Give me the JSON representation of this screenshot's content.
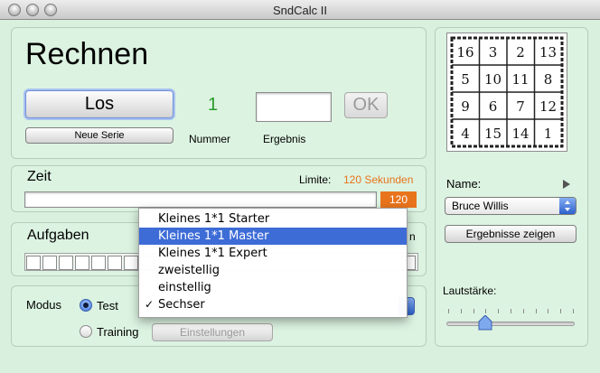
{
  "window": {
    "title": "SndCalc II"
  },
  "rechnen": {
    "heading": "Rechnen",
    "los_label": "Los",
    "neue_serie_label": "Neue Serie",
    "nummer_value": "1",
    "nummer_label": "Nummer",
    "ergebnis_label": "Ergebnis",
    "ok_label": "OK"
  },
  "zeit": {
    "heading": "Zeit",
    "limite_label": "Limite:",
    "limite_value": "120 Sekunden",
    "counter": "120"
  },
  "aufgaben": {
    "heading": "Aufgaben",
    "right_fragment": "n"
  },
  "modus": {
    "label": "Modus",
    "option_test": "Test",
    "option_training": "Training",
    "selected": "Test",
    "einstellungen_label": "Einstellungen"
  },
  "sidebar": {
    "name_label": "Name:",
    "name_value": "Bruce Willis",
    "ergebnisse_label": "Ergebnisse zeigen",
    "lautstaerke_label": "Lautstärke:",
    "volume_level": 0.3,
    "magic_square": [
      "16",
      "3",
      "2",
      "13",
      "5",
      "10",
      "11",
      "8",
      "9",
      "6",
      "7",
      "12",
      "4",
      "15",
      "14",
      "1"
    ]
  },
  "menu": {
    "items": [
      {
        "label": "Kleines 1*1 Starter",
        "selected": false,
        "checked": false
      },
      {
        "label": "Kleines 1*1 Master",
        "selected": true,
        "checked": false
      },
      {
        "label": "Kleines 1*1 Expert",
        "selected": false,
        "checked": false
      },
      {
        "label": "zweistellig",
        "selected": false,
        "checked": false
      },
      {
        "label": "einstellig",
        "selected": false,
        "checked": false
      },
      {
        "label": "Sechser",
        "selected": false,
        "checked": true
      }
    ],
    "check_glyph": "✓"
  },
  "colors": {
    "accent_orange": "#e8741c",
    "nummer_green": "#2a9a2a",
    "menu_highlight": "#3d6cd7"
  }
}
